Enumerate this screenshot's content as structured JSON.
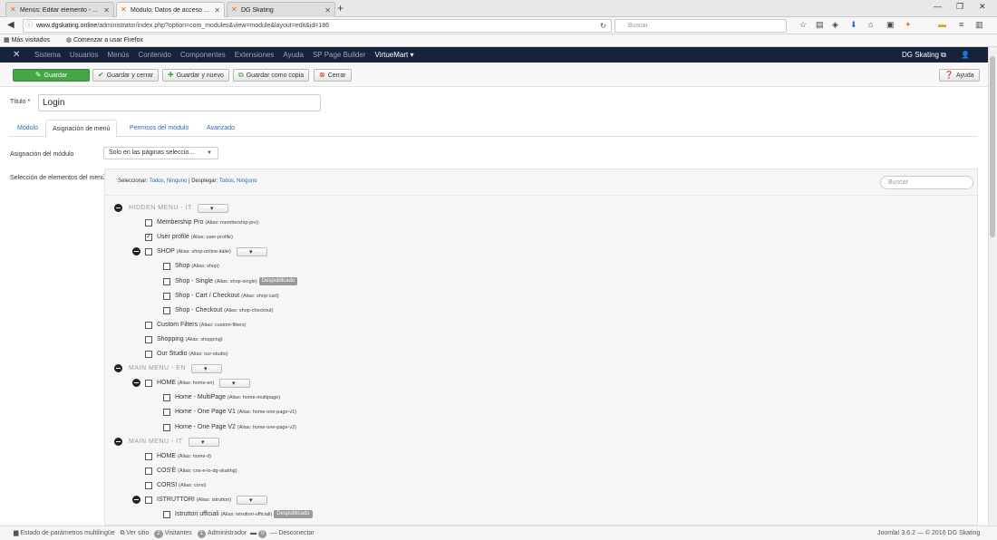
{
  "browser": {
    "tabs": [
      {
        "label": "Menús: Editar elemento - ...",
        "active": false
      },
      {
        "label": "Módulo: Datos de acceso ...",
        "active": true
      },
      {
        "label": "DG Skating",
        "active": false
      }
    ],
    "url_domain": "www.dgskating.online",
    "url_path": "/administrator/index.php?option=com_modules&view=module&layout=edit&id=186",
    "search_placeholder": "Buscar",
    "bookmarks": [
      "Más visitados",
      "Comenzar a usar Firefox"
    ]
  },
  "adminbar": {
    "menu": [
      "Sistema",
      "Usuarios",
      "Menús",
      "Contenido",
      "Componentes",
      "Extensiones",
      "Ayuda",
      "SP Page Builder",
      "VirtueMart ▾"
    ],
    "site_label": "DG Skating ⧉",
    "user_icon": "user-icon"
  },
  "toolbar": {
    "save": "Guardar",
    "save_close": "Guardar y cerrar",
    "save_new": "Guardar y nuevo",
    "save_copy": "Guardar como copia",
    "close": "Cerrar",
    "help": "Ayuda"
  },
  "form": {
    "title_label": "Título *",
    "title_value": "Login",
    "tabs": [
      "Módulo",
      "Asignación de menú",
      "Permisos del módulo",
      "Avanzado"
    ],
    "active_tab": 1,
    "assign_label": "Asignación del módulo",
    "assign_value": "Solo en las páginas seleccio...",
    "selection_label": "Selección de elementos del menú:"
  },
  "tree": {
    "select_prefix": "Seleccionar:",
    "select_all": "Todos",
    "select_none": "Ninguno",
    "expand_prefix": "| Desplegar:",
    "expand_all": "Todos",
    "expand_none": "Ninguno",
    "search_placeholder": "Buscar",
    "rows": [
      {
        "type": "menu",
        "label": "HIDDEN MENU - IT"
      },
      {
        "type": "item",
        "level": 1,
        "label": "Membership Pro",
        "alias": "(Alias: membership-pro)",
        "checked": false
      },
      {
        "type": "item",
        "level": 1,
        "label": "User profile",
        "alias": "(Alias: user-profile)",
        "checked": true
      },
      {
        "type": "item",
        "level": 1,
        "label": "SHOP",
        "alias": "(Alias: shop-online-italie)",
        "checked": false,
        "parent": true
      },
      {
        "type": "item",
        "level": 2,
        "label": "Shop",
        "alias": "(Alias: shop)",
        "checked": false
      },
      {
        "type": "item",
        "level": 2,
        "label": "Shop - Single",
        "alias": "(Alias: shop-single)",
        "checked": false,
        "badge": "Despublicado"
      },
      {
        "type": "item",
        "level": 2,
        "label": "Shop - Cart / Checkout",
        "alias": "(Alias: shop-cart)",
        "checked": false
      },
      {
        "type": "item",
        "level": 2,
        "label": "Shop - Checkout",
        "alias": "(Alias: shop-checkout)",
        "checked": false
      },
      {
        "type": "item",
        "level": 1,
        "label": "Custom Filters",
        "alias": "(Alias: custom-filters)",
        "checked": false
      },
      {
        "type": "item",
        "level": 1,
        "label": "Shopping",
        "alias": "(Alias: shopping)",
        "checked": false
      },
      {
        "type": "item",
        "level": 1,
        "label": "Our Studio",
        "alias": "(Alias: our-studio)",
        "checked": false
      },
      {
        "type": "menu",
        "label": "MAIN MENU - EN"
      },
      {
        "type": "item",
        "level": 1,
        "label": "HOME",
        "alias": "(Alias: home-en)",
        "checked": false,
        "parent": true
      },
      {
        "type": "item",
        "level": 2,
        "label": "Home - MultiPage",
        "alias": "(Alias: home-multipage)",
        "checked": false
      },
      {
        "type": "item",
        "level": 2,
        "label": "Home - One Page V1",
        "alias": "(Alias: home-one-page-v1)",
        "checked": false
      },
      {
        "type": "item",
        "level": 2,
        "label": "Home - One Page V2",
        "alias": "(Alias: home-one-page-v2)",
        "checked": false
      },
      {
        "type": "menu",
        "label": "MAIN MENU - IT"
      },
      {
        "type": "item",
        "level": 1,
        "label": "HOME",
        "alias": "(Alias: home-it)",
        "checked": false
      },
      {
        "type": "item",
        "level": 1,
        "label": "COS'È",
        "alias": "(Alias: cos-e-lo-dg-skating)",
        "checked": false
      },
      {
        "type": "item",
        "level": 1,
        "label": "CORSI",
        "alias": "(Alias: corsi)",
        "checked": false
      },
      {
        "type": "item",
        "level": 1,
        "label": "ISTRUTTORI",
        "alias": "(Alias: istruttori)",
        "checked": false,
        "parent": true
      },
      {
        "type": "item",
        "level": 2,
        "label": "Istruttori ufficiali",
        "alias": "(Alias: istruttori-ufficiali)",
        "checked": false,
        "badge": "Despublicado"
      }
    ]
  },
  "statusbar": {
    "multilang": "Estado de parámetros multilingüe",
    "view_site": "Ver sitio",
    "visitors_count": "2",
    "visitors": "Visitantes",
    "admin_count": "1",
    "admin": "Administrador",
    "messages_count": "0",
    "logout": "Desconectar",
    "footer": "Joomla! 3.6.2 — © 2016 DG Skating"
  }
}
